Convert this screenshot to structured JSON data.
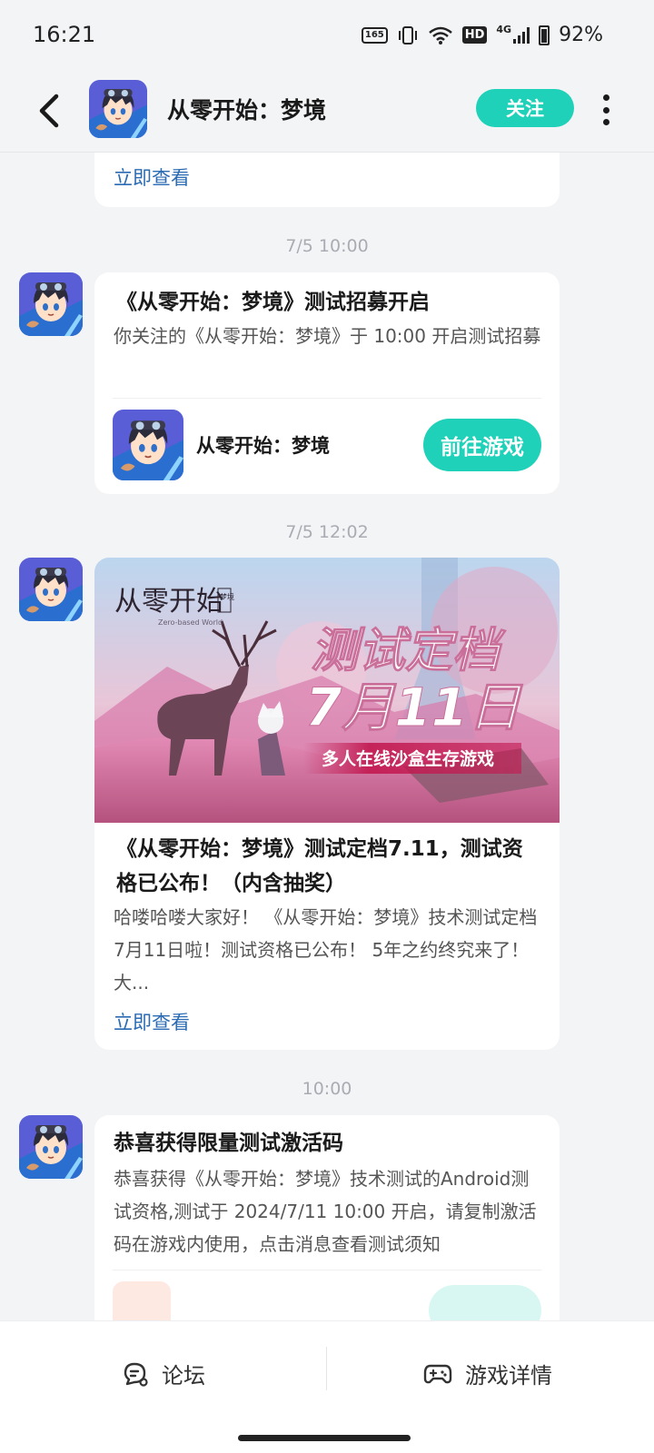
{
  "status_bar": {
    "time": "16:21",
    "refresh_badge": "165",
    "network": "4G",
    "hd": "HD",
    "battery": "92%"
  },
  "nav": {
    "title": "从零开始：梦境",
    "follow_label": "关注"
  },
  "top_card": {
    "link": "立即查看"
  },
  "messages": [
    {
      "time": "7/5  10:00",
      "title": "《从零开始：梦境》测试招募开启",
      "text": "你关注的《从零开始：梦境》于 10:00 开启测试招募",
      "game_name": "从零开始：梦境",
      "action_label": "前往游戏"
    },
    {
      "time": "7/5  12:02",
      "banner": {
        "logo": "从零开始",
        "logo_sub": "梦境",
        "logo_en": "Zero-based World",
        "headline": "测试定档",
        "date": "7月11日",
        "tagline": "多人在线沙盒生存游戏"
      },
      "title": "《从零开始：梦境》测试定档7.11，测试资格已公布！（内含抽奖）",
      "text": "哈喽哈喽大家好！ 《从零开始：梦境》技术测试定档7月11日啦！测试资格已公布！ 5年之约终究来了！大...",
      "link": "立即查看"
    },
    {
      "time": "10:00",
      "title": "恭喜获得限量测试激活码",
      "text": "恭喜获得《从零开始：梦境》技术测试的Android测试资格,测试于 2024/7/11 10:00 开启，请复制激活码在游戏内使用，点击消息查看测试须知"
    }
  ],
  "bottom_tabs": [
    {
      "label": "论坛",
      "icon": "forum-icon"
    },
    {
      "label": "游戏详情",
      "icon": "gamepad-icon"
    }
  ],
  "colors": {
    "accent": "#1fd1b8",
    "link": "#2b6bb3",
    "background": "#f3f4f6"
  }
}
